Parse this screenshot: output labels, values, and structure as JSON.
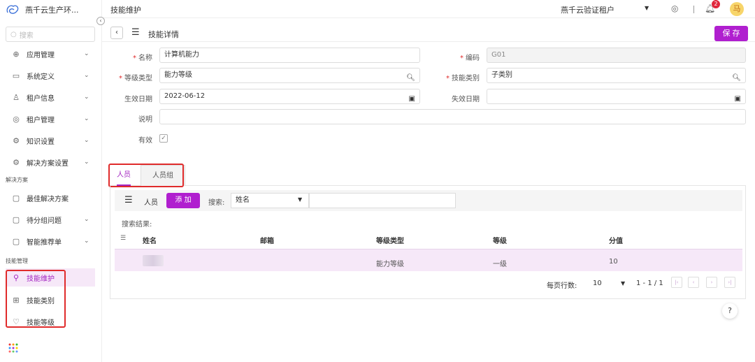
{
  "brand": {
    "name": "燕千云生产环...",
    "collapse_icon": "‹"
  },
  "sidebar": {
    "search_placeholder": "搜索",
    "items": [
      {
        "label": "应用管理",
        "icon": "⊕"
      },
      {
        "label": "系统定义",
        "icon": "▭"
      },
      {
        "label": "租户信息",
        "icon": "♙"
      },
      {
        "label": "租户管理",
        "icon": "◎"
      },
      {
        "label": "知识设置",
        "icon": "⚙"
      },
      {
        "label": "解决方案设置",
        "icon": "⚙"
      }
    ],
    "group1": "解决方案",
    "group1_items": [
      {
        "label": "最佳解决方案",
        "icon": "▢"
      },
      {
        "label": "待分组问题",
        "icon": "▢"
      },
      {
        "label": "智能推荐单",
        "icon": "▢"
      }
    ],
    "group2": "技能管理",
    "group2_items": [
      {
        "label": "技能维护",
        "icon": "⚲"
      },
      {
        "label": "技能类别",
        "icon": "⊞"
      },
      {
        "label": "技能等级",
        "icon": "♡"
      }
    ]
  },
  "topbar": {
    "title": "技能维护",
    "tenant": "燕千云验证租户",
    "notification_count": "2",
    "avatar_text": "马"
  },
  "detail": {
    "back": "‹",
    "title": "技能详情",
    "save_label": "保 存"
  },
  "form": {
    "name_label": "名称",
    "name_value": "计算机能力",
    "code_label": "编码",
    "code_value": "G01",
    "level_type_label": "等级类型",
    "level_type_value": "能力等级",
    "category_label": "技能类别",
    "category_value": "子类别",
    "start_label": "生效日期",
    "start_value": "2022-06-12",
    "end_label": "失效日期",
    "end_value": "",
    "desc_label": "说明",
    "desc_value": "",
    "valid_label": "有效",
    "valid_check": "✓"
  },
  "tabs": [
    {
      "label": "人员"
    },
    {
      "label": "人员组"
    }
  ],
  "toolbar": {
    "label": "人员",
    "add_label": "添 加",
    "search_label": "搜索:",
    "search_field": "姓名"
  },
  "table": {
    "result_label": "搜索结果:",
    "headers": [
      "姓名",
      "邮箱",
      "等级类型",
      "等级",
      "分值"
    ],
    "rows": [
      {
        "name": "",
        "email": "",
        "level_type": "能力等级",
        "level": "一级",
        "score": "10"
      }
    ]
  },
  "pager": {
    "rows_per_page_label": "每页行数:",
    "page_size": "10",
    "range": "1 - 1 / 1"
  },
  "colors": {
    "accent": "#b01fcf",
    "highlight_box": "#e02b2b"
  }
}
